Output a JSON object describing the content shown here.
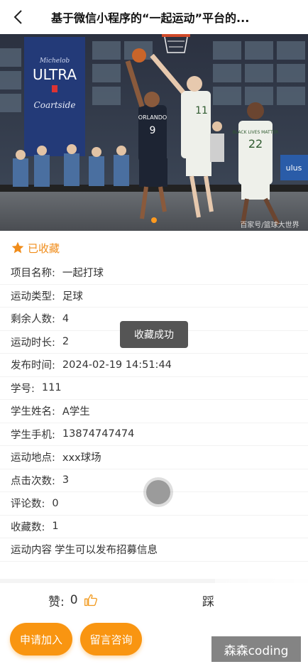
{
  "header": {
    "title": "基于微信小程序的“一起运动”平台的..."
  },
  "hero": {
    "banner_text": "ULTRA",
    "banner_brand": "Michelob",
    "banner_sub": "Coartside",
    "jersey_left": "9",
    "jersey_left_team": "ORLANDO",
    "jersey_mid": "11",
    "jersey_right": "22",
    "jersey_right_team": "BLACK LIVES MATTER",
    "side_text": "ulus",
    "credit": "百家号/篮球大世界"
  },
  "favorite": {
    "label": "已收藏",
    "icon": "star-icon"
  },
  "details": [
    {
      "key": "项目名称:",
      "value": "一起打球"
    },
    {
      "key": "运动类型:",
      "value": "足球"
    },
    {
      "key": "剩余人数:",
      "value": "4"
    },
    {
      "key": "运动时长:",
      "value": "2"
    },
    {
      "key": "发布时间:",
      "value": "2024-02-19 14:51:44"
    },
    {
      "key": "学号:",
      "value": "111"
    },
    {
      "key": "学生姓名:",
      "value": "A学生"
    },
    {
      "key": "学生手机:",
      "value": "13874747474"
    },
    {
      "key": "运动地点:",
      "value": "xxx球场"
    },
    {
      "key": "点击次数:",
      "value": "3"
    },
    {
      "key": "评论数:",
      "value": "0"
    },
    {
      "key": "收藏数:",
      "value": "1"
    },
    {
      "key": "运动内容",
      "value": "学生可以发布招募信息"
    }
  ],
  "reactions": {
    "like_label": "赞:",
    "like_count": "0",
    "dislike_label": "踩"
  },
  "actions": {
    "join_label": "申请加入",
    "ask_label": "留言咨询"
  },
  "toast": {
    "text": "收藏成功"
  },
  "watermark": {
    "text": "森森coding"
  },
  "colors": {
    "accent": "#f99511",
    "favorite": "#f08c1a"
  }
}
